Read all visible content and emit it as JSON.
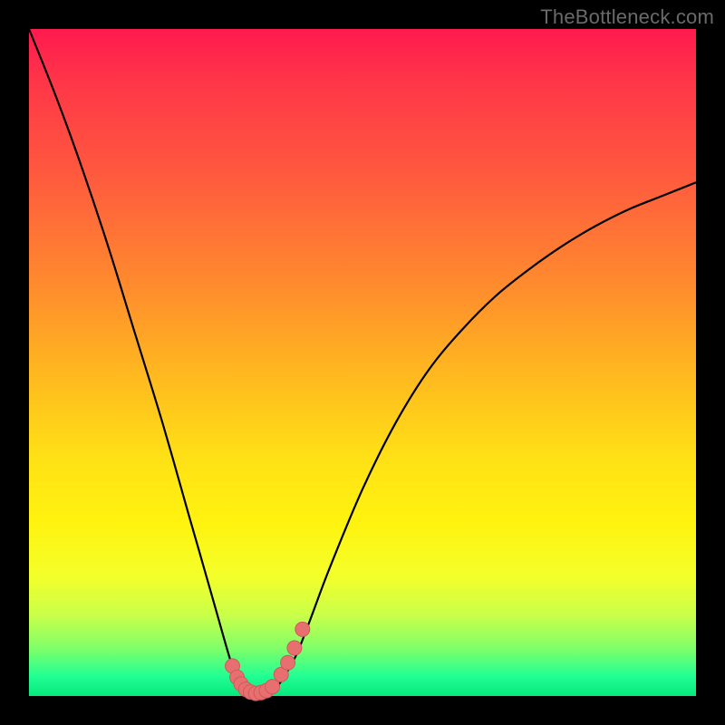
{
  "watermark": "TheBottleneck.com",
  "colors": {
    "frame": "#000000",
    "curve": "#000000",
    "marker_fill": "#e76f6f",
    "marker_stroke": "#cf5a5a",
    "gradient_top": "#ff1a4f",
    "gradient_bottom": "#06e97e"
  },
  "chart_data": {
    "type": "line",
    "title": "",
    "xlabel": "",
    "ylabel": "",
    "xlim": [
      0,
      100
    ],
    "ylim": [
      0,
      100
    ],
    "grid": false,
    "legend": false,
    "x": [
      0,
      4,
      8,
      12,
      16,
      20,
      24,
      26,
      28,
      30,
      31,
      32,
      33,
      34,
      35,
      36,
      37,
      38,
      40,
      42,
      45,
      50,
      55,
      60,
      65,
      70,
      75,
      80,
      85,
      90,
      95,
      100
    ],
    "y": [
      100,
      90,
      79,
      67,
      54,
      41,
      27,
      20,
      13,
      6,
      3,
      1.5,
      0.7,
      0.4,
      0.4,
      0.6,
      1.2,
      2.5,
      6,
      11,
      19,
      31,
      41,
      49,
      55,
      60,
      64,
      67.5,
      70.5,
      73,
      75,
      77
    ],
    "markers": {
      "x": [
        30.5,
        31.2,
        31.8,
        32.5,
        33.2,
        34.0,
        34.8,
        35.6,
        36.5,
        37.8,
        38.8,
        39.8,
        41.0
      ],
      "y": [
        4.5,
        2.8,
        1.8,
        1.0,
        0.6,
        0.4,
        0.5,
        0.8,
        1.4,
        3.2,
        5.0,
        7.2,
        10.0
      ]
    }
  }
}
